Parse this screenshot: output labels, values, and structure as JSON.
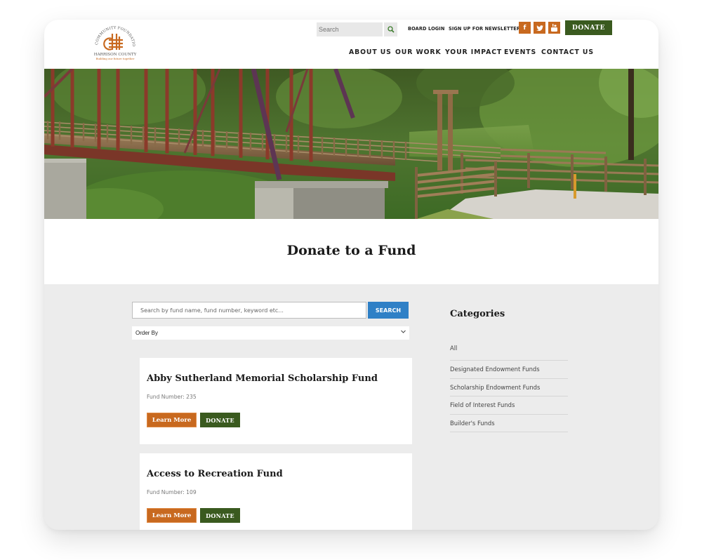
{
  "header": {
    "logo": {
      "arc_text": "COMMUNITY FOUNDATION",
      "name": "HARRISON COUNTY",
      "tagline": "Building our future together"
    },
    "search": {
      "placeholder": "Search",
      "icon": "search-icon"
    },
    "links": [
      "BOARD LOGIN",
      "SIGN UP FOR NEWSLETTER"
    ],
    "social": [
      {
        "name": "facebook",
        "glyph": "f"
      },
      {
        "name": "twitter",
        "glyph": "t"
      },
      {
        "name": "youtube",
        "glyph": "y"
      }
    ],
    "donate_label": "DONATE",
    "nav": [
      "ABOUT US",
      "OUR WORK",
      "YOUR IMPACT",
      "EVENTS",
      "CONTACT US"
    ]
  },
  "hero": {
    "description": "Red steel truss pedestrian bridge with wooden railings over a green river valley"
  },
  "page": {
    "title": "Donate to a Fund"
  },
  "fund_search": {
    "placeholder": "Search by fund name, fund number, keyword etc...",
    "button_label": "SEARCH",
    "order_by": "Order By"
  },
  "funds": [
    {
      "name": "Abby Sutherland Memorial Scholarship Fund",
      "number_label": "Fund Number: 235",
      "learn_more": "Learn More",
      "donate": "DONATE"
    },
    {
      "name": "Access to Recreation Fund",
      "number_label": "Fund Number: 109",
      "learn_more": "Learn More",
      "donate": "DONATE"
    }
  ],
  "categories": {
    "title": "Categories",
    "items": [
      "All",
      "Designated Endowment Funds",
      "Scholarship Endowment Funds",
      "Field of Interest Funds",
      "Builder's Funds"
    ]
  },
  "colors": {
    "brand_orange": "#c8691f",
    "brand_green": "#3a5a1f",
    "search_blue": "#2f80c6",
    "content_bg": "#ececec"
  }
}
